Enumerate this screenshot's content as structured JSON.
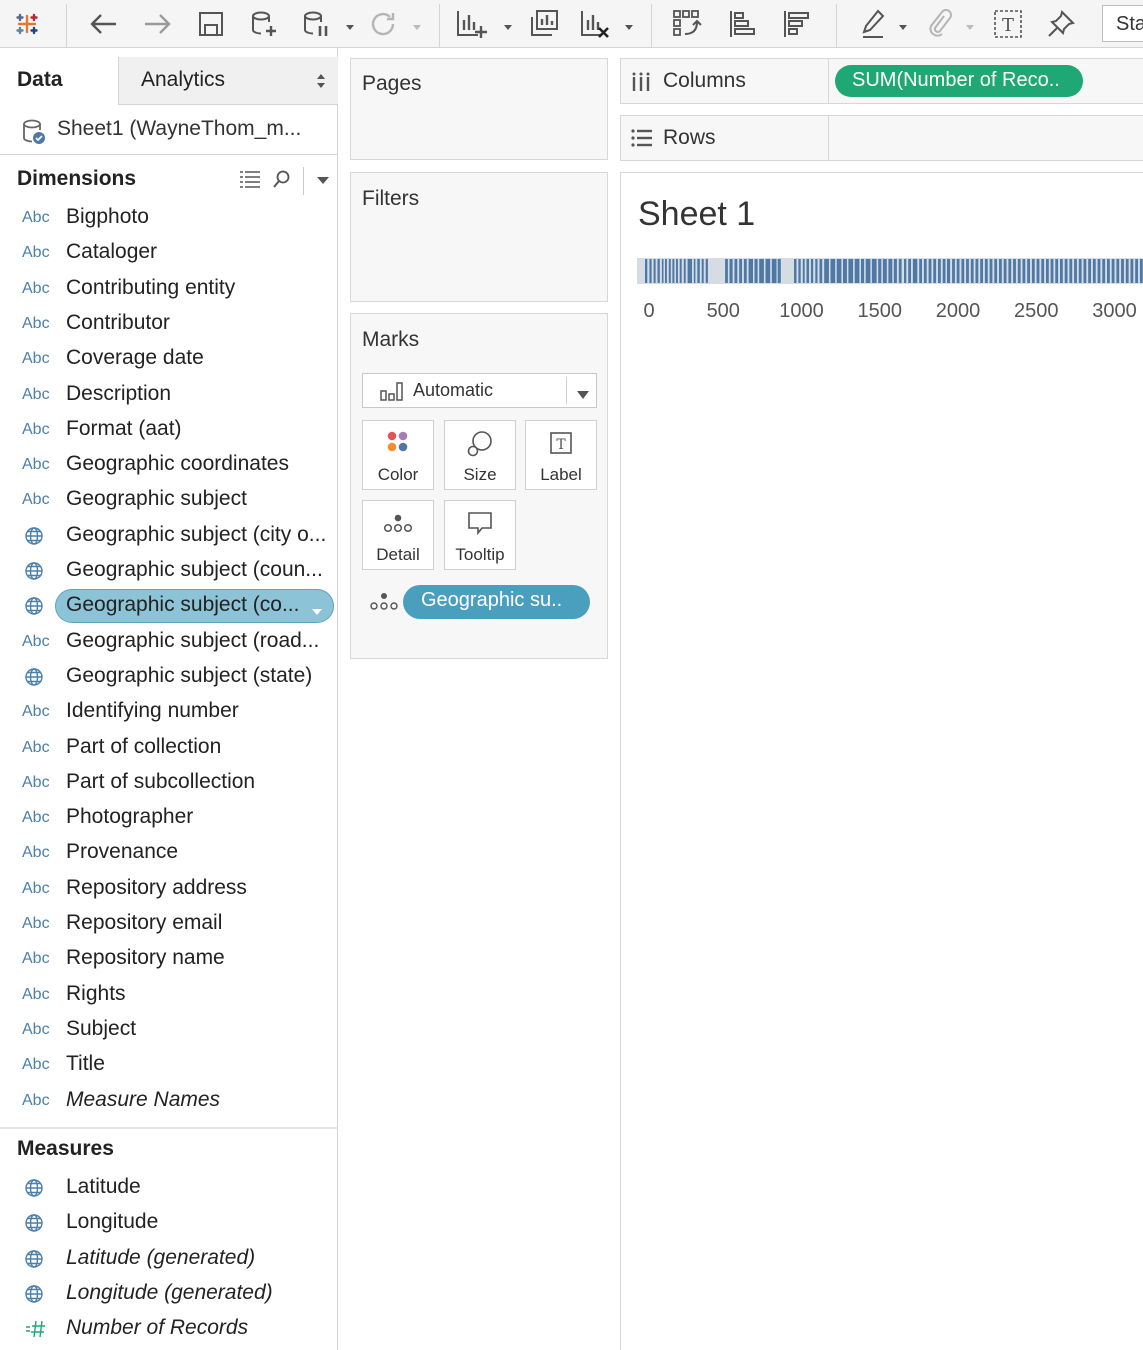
{
  "toolbar": {
    "icons": [
      "tableau-logo-icon",
      "undo-icon",
      "redo-icon",
      "save-icon",
      "new-data-source-icon",
      "pause-auto-updates-icon",
      "refresh-icon",
      "new-worksheet-icon",
      "duplicate-sheet-icon",
      "clear-sheet-icon",
      "swap-rows-columns-icon",
      "sort-ascending-icon",
      "sort-descending-icon",
      "highlight-icon",
      "group-members-icon",
      "show-mark-labels-icon",
      "fix-axes-icon"
    ],
    "fit_label": "Standard"
  },
  "data_pane": {
    "tab_data": "Data",
    "tab_analytics": "Analytics",
    "datasource": "Sheet1 (WayneThom_m...",
    "dimensions_title": "Dimensions",
    "dimensions": [
      {
        "type": "Abc",
        "label": "Bigphoto"
      },
      {
        "type": "Abc",
        "label": "Cataloger"
      },
      {
        "type": "Abc",
        "label": "Contributing entity"
      },
      {
        "type": "Abc",
        "label": "Contributor"
      },
      {
        "type": "Abc",
        "label": "Coverage date"
      },
      {
        "type": "Abc",
        "label": "Description"
      },
      {
        "type": "Abc",
        "label": "Format (aat)"
      },
      {
        "type": "Abc",
        "label": "Geographic coordinates"
      },
      {
        "type": "Abc",
        "label": "Geographic subject"
      },
      {
        "type": "globe",
        "label": "Geographic subject (city o..."
      },
      {
        "type": "globe",
        "label": "Geographic subject (coun..."
      },
      {
        "type": "globe",
        "label": "Geographic subject (co...",
        "selected": true
      },
      {
        "type": "Abc",
        "label": "Geographic subject (road..."
      },
      {
        "type": "globe",
        "label": "Geographic subject (state)"
      },
      {
        "type": "Abc",
        "label": "Identifying number"
      },
      {
        "type": "Abc",
        "label": "Part of collection"
      },
      {
        "type": "Abc",
        "label": "Part of subcollection"
      },
      {
        "type": "Abc",
        "label": "Photographer"
      },
      {
        "type": "Abc",
        "label": "Provenance"
      },
      {
        "type": "Abc",
        "label": "Repository address"
      },
      {
        "type": "Abc",
        "label": "Repository email"
      },
      {
        "type": "Abc",
        "label": "Repository name"
      },
      {
        "type": "Abc",
        "label": "Rights"
      },
      {
        "type": "Abc",
        "label": "Subject"
      },
      {
        "type": "Abc",
        "label": "Title"
      },
      {
        "type": "Abc",
        "label": "Measure Names",
        "italic": true
      }
    ],
    "measures_title": "Measures",
    "measures": [
      {
        "type": "globe",
        "label": "Latitude"
      },
      {
        "type": "globe",
        "label": "Longitude"
      },
      {
        "type": "globe",
        "label": "Latitude (generated)",
        "italic": true
      },
      {
        "type": "globe",
        "label": "Longitude (generated)",
        "italic": true
      },
      {
        "type": "measure",
        "label": "Number of Records",
        "italic": true
      }
    ]
  },
  "cards": {
    "pages_title": "Pages",
    "filters_title": "Filters",
    "marks_title": "Marks",
    "mark_type": "Automatic",
    "mark_buttons": {
      "color": "Color",
      "size": "Size",
      "label": "Label",
      "detail": "Detail",
      "tooltip": "Tooltip"
    },
    "detail_pill": "Geographic su.."
  },
  "shelves": {
    "columns_label": "Columns",
    "columns_pill": "SUM(Number of Reco..",
    "rows_label": "Rows"
  },
  "view": {
    "sheet_title": "Sheet 1"
  },
  "chart_data": {
    "type": "strip",
    "title": "Sheet 1",
    "x_field": "SUM(Number of Records)",
    "x_ticks": [
      0,
      500,
      1000,
      1500,
      2000,
      2500,
      3000
    ],
    "xlim": [
      0,
      3200
    ],
    "bar_color": "#4e79a7",
    "segments": [
      [
        0,
        15
      ],
      [
        28,
        42
      ],
      [
        55,
        68
      ],
      [
        80,
        95
      ],
      [
        108,
        118
      ],
      [
        128,
        140
      ],
      [
        152,
        165
      ],
      [
        175,
        188
      ],
      [
        198,
        210
      ],
      [
        222,
        235
      ],
      [
        248,
        260
      ],
      [
        272,
        300
      ],
      [
        312,
        322
      ],
      [
        334,
        350
      ],
      [
        362,
        375
      ],
      [
        388,
        402
      ],
      [
        512,
        530
      ],
      [
        540,
        560
      ],
      [
        572,
        590
      ],
      [
        602,
        620
      ],
      [
        632,
        650
      ],
      [
        662,
        690
      ],
      [
        700,
        720
      ],
      [
        730,
        760
      ],
      [
        770,
        800
      ],
      [
        810,
        840
      ],
      [
        848,
        868
      ],
      [
        952,
        968
      ],
      [
        980,
        995
      ],
      [
        1008,
        1020
      ],
      [
        1032,
        1048
      ],
      [
        1060,
        1075
      ],
      [
        1088,
        1102
      ],
      [
        1115,
        1132
      ],
      [
        1145,
        1175
      ],
      [
        1185,
        1215
      ],
      [
        1225,
        1255
      ],
      [
        1265,
        1290
      ],
      [
        1300,
        1330
      ],
      [
        1340,
        1370
      ],
      [
        1380,
        1400
      ],
      [
        1410,
        1440
      ],
      [
        1450,
        1480
      ],
      [
        1490,
        1510
      ],
      [
        1520,
        1545
      ],
      [
        1555,
        1580
      ],
      [
        1590,
        1610
      ],
      [
        1622,
        1640
      ],
      [
        1655,
        1670
      ],
      [
        1682,
        1700
      ],
      [
        1712,
        1740
      ],
      [
        1752,
        1770
      ],
      [
        1782,
        1800
      ],
      [
        1812,
        1830
      ],
      [
        1842,
        1860
      ],
      [
        1872,
        1890
      ],
      [
        1902,
        1920
      ],
      [
        1930,
        1950
      ],
      [
        1962,
        1980
      ],
      [
        1992,
        2010
      ],
      [
        2022,
        2040
      ],
      [
        2052,
        2070
      ],
      [
        2082,
        2100
      ],
      [
        2112,
        2130
      ],
      [
        2142,
        2160
      ],
      [
        2172,
        2190
      ],
      [
        2202,
        2220
      ],
      [
        2232,
        2250
      ],
      [
        2262,
        2280
      ],
      [
        2292,
        2310
      ],
      [
        2322,
        2340
      ],
      [
        2352,
        2370
      ],
      [
        2382,
        2400
      ],
      [
        2412,
        2430
      ],
      [
        2442,
        2460
      ],
      [
        2472,
        2490
      ],
      [
        2502,
        2520
      ],
      [
        2532,
        2550
      ],
      [
        2562,
        2580
      ],
      [
        2592,
        2610
      ],
      [
        2622,
        2640
      ],
      [
        2652,
        2670
      ],
      [
        2682,
        2700
      ],
      [
        2712,
        2730
      ],
      [
        2742,
        2760
      ],
      [
        2772,
        2790
      ],
      [
        2802,
        2820
      ],
      [
        2832,
        2850
      ],
      [
        2862,
        2880
      ],
      [
        2892,
        2910
      ],
      [
        2922,
        2940
      ],
      [
        2952,
        2970
      ],
      [
        2982,
        3000
      ],
      [
        3012,
        3030
      ],
      [
        3042,
        3060
      ],
      [
        3072,
        3090
      ],
      [
        3102,
        3120
      ],
      [
        3132,
        3150
      ],
      [
        3162,
        3180
      ]
    ]
  }
}
